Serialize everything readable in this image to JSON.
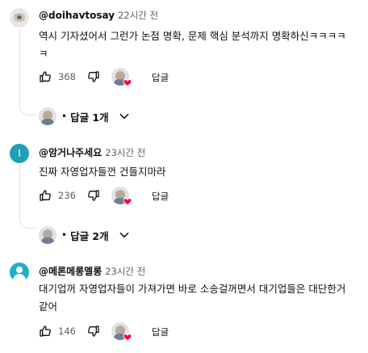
{
  "colors": {
    "heart": "#ff0033",
    "text": "#0f0f0f",
    "muted": "#606060",
    "letter_avatar": "#1fa0b8",
    "person_avatar": "#1fb0c4"
  },
  "comments": [
    {
      "author": "@doihavtosay",
      "time": "22시간 전",
      "text_lines": [
        "역시 기자셨어서 그런가 논점 명확, 문제 핵심 분석까지 명확하신ㅋㅋㅋㅋ",
        "ㅋ"
      ],
      "likes": "368",
      "reply_label": "답글",
      "replies_label": "답글 1개",
      "avatar_icon": "camera-avatar-icon"
    },
    {
      "author": "@암거나주세요",
      "time": "23시간 전",
      "avatar_letter": "I",
      "text_lines": [
        "진짜 자영업자들껀 건들지마라"
      ],
      "likes": "236",
      "reply_label": "답글",
      "replies_label": "답글 2개"
    },
    {
      "author": "@메론메롱멜롱",
      "time": "23시간 전",
      "text_lines": [
        "대기업꺼 자영업자들이 가져가면 바로 소송걸꺼면서 대기업들은 대단한거",
        "같어"
      ],
      "likes": "146",
      "reply_label": "답글",
      "avatar_icon": "person-avatar-icon"
    }
  ],
  "icons": {
    "like": "thumbs-up-icon",
    "dislike": "thumbs-down-icon",
    "heart": "heart-icon",
    "expand": "chevron-down-icon"
  }
}
